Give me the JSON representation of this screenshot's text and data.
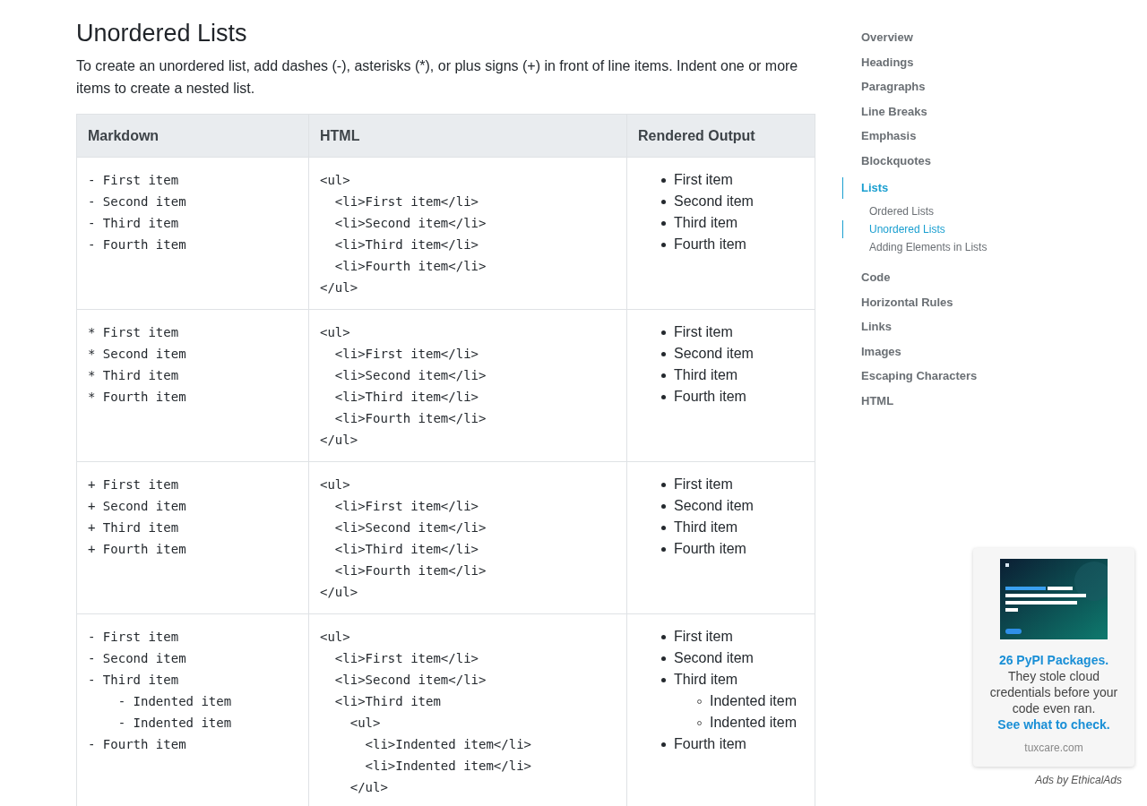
{
  "article": {
    "title": "Unordered Lists",
    "intro": "To create an unordered list, add dashes (-), asterisks (*), or plus signs (+) in front of line items. Indent one or more items to create a nested list."
  },
  "table": {
    "columns": [
      "Markdown",
      "HTML",
      "Rendered Output"
    ],
    "rows": [
      {
        "markdown": [
          "- First item",
          "- Second item",
          "- Third item",
          "- Fourth item"
        ],
        "html": [
          "<ul>",
          "  <li>First item</li>",
          "  <li>Second item</li>",
          "  <li>Third item</li>",
          "  <li>Fourth item</li>",
          "</ul>"
        ],
        "rendered": [
          {
            "text": "First item"
          },
          {
            "text": "Second item"
          },
          {
            "text": "Third item"
          },
          {
            "text": "Fourth item"
          }
        ]
      },
      {
        "markdown": [
          "* First item",
          "* Second item",
          "* Third item",
          "* Fourth item"
        ],
        "html": [
          "<ul>",
          "  <li>First item</li>",
          "  <li>Second item</li>",
          "  <li>Third item</li>",
          "  <li>Fourth item</li>",
          "</ul>"
        ],
        "rendered": [
          {
            "text": "First item"
          },
          {
            "text": "Second item"
          },
          {
            "text": "Third item"
          },
          {
            "text": "Fourth item"
          }
        ]
      },
      {
        "markdown": [
          "+ First item",
          "+ Second item",
          "+ Third item",
          "+ Fourth item"
        ],
        "html": [
          "<ul>",
          "  <li>First item</li>",
          "  <li>Second item</li>",
          "  <li>Third item</li>",
          "  <li>Fourth item</li>",
          "</ul>"
        ],
        "rendered": [
          {
            "text": "First item"
          },
          {
            "text": "Second item"
          },
          {
            "text": "Third item"
          },
          {
            "text": "Fourth item"
          }
        ]
      },
      {
        "markdown": [
          "- First item",
          "- Second item",
          "- Third item",
          "    - Indented item",
          "    - Indented item",
          "- Fourth item"
        ],
        "html": [
          "<ul>",
          "  <li>First item</li>",
          "  <li>Second item</li>",
          "  <li>Third item",
          "    <ul>",
          "      <li>Indented item</li>",
          "      <li>Indented item</li>",
          "    </ul>"
        ],
        "rendered": [
          {
            "text": "First item"
          },
          {
            "text": "Second item"
          },
          {
            "text": "Third item",
            "children": [
              {
                "text": "Indented item"
              },
              {
                "text": "Indented item"
              }
            ]
          },
          {
            "text": "Fourth item"
          }
        ]
      }
    ]
  },
  "sidebar": {
    "items": [
      {
        "label": "Overview",
        "selected": false
      },
      {
        "label": "Headings",
        "selected": false
      },
      {
        "label": "Paragraphs",
        "selected": false
      },
      {
        "label": "Line Breaks",
        "selected": false
      },
      {
        "label": "Emphasis",
        "selected": false
      },
      {
        "label": "Blockquotes",
        "selected": false
      },
      {
        "label": "Lists",
        "selected": true,
        "children": [
          {
            "label": "Ordered Lists",
            "selected": false
          },
          {
            "label": "Unordered Lists",
            "selected": true
          },
          {
            "label": "Adding Elements in Lists",
            "selected": false
          }
        ]
      },
      {
        "label": "Code",
        "selected": false
      },
      {
        "label": "Horizontal Rules",
        "selected": false
      },
      {
        "label": "Links",
        "selected": false
      },
      {
        "label": "Images",
        "selected": false
      },
      {
        "label": "Escaping Characters",
        "selected": false
      },
      {
        "label": "HTML",
        "selected": false
      }
    ]
  },
  "ad": {
    "headline": "26 PyPI Packages.",
    "body": "They stole cloud credentials before your code even ran.",
    "link": "See what to check.",
    "domain": "tuxcare.com",
    "footer": "Ads by EthicalAds"
  }
}
